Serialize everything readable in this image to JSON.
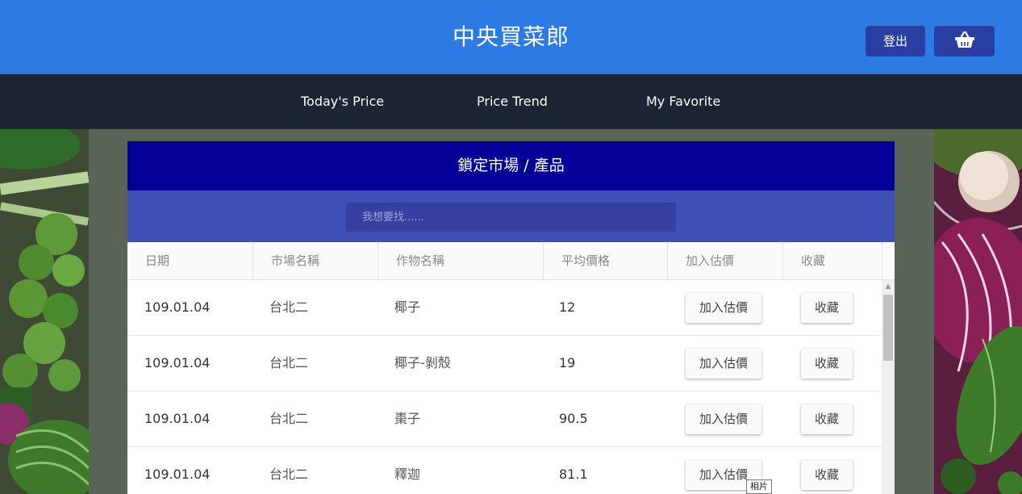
{
  "header": {
    "brand": "中央買菜郎",
    "logout_label": "登出",
    "cart_icon": "shopping-basket-icon",
    "colors": {
      "header_bg": "#2c7be5",
      "button_bg": "#2a3fa3"
    }
  },
  "nav": {
    "items": [
      {
        "label": "Today's Price"
      },
      {
        "label": "Price Trend"
      },
      {
        "label": "My Favorite"
      }
    ]
  },
  "panel": {
    "title": "鎖定市場 / 產品",
    "search_placeholder": "我想要找......",
    "columns": [
      "日期",
      "市場名稱",
      "作物名稱",
      "平均價格",
      "加入估價",
      "收藏"
    ],
    "rows": [
      {
        "date": "109.01.04",
        "market": "台北二",
        "crop": "椰子",
        "price": "12",
        "estimate_label": "加入估價",
        "favorite_label": "收藏"
      },
      {
        "date": "109.01.04",
        "market": "台北二",
        "crop": "椰子-剝殼",
        "price": "19",
        "estimate_label": "加入估價",
        "favorite_label": "收藏"
      },
      {
        "date": "109.01.04",
        "market": "台北二",
        "crop": "棗子",
        "price": "90.5",
        "estimate_label": "加入估價",
        "favorite_label": "收藏"
      },
      {
        "date": "109.01.04",
        "market": "台北二",
        "crop": "釋迦",
        "price": "81.1",
        "estimate_label": "加入估價",
        "favorite_label": "收藏"
      }
    ]
  },
  "tooltip": "相片"
}
